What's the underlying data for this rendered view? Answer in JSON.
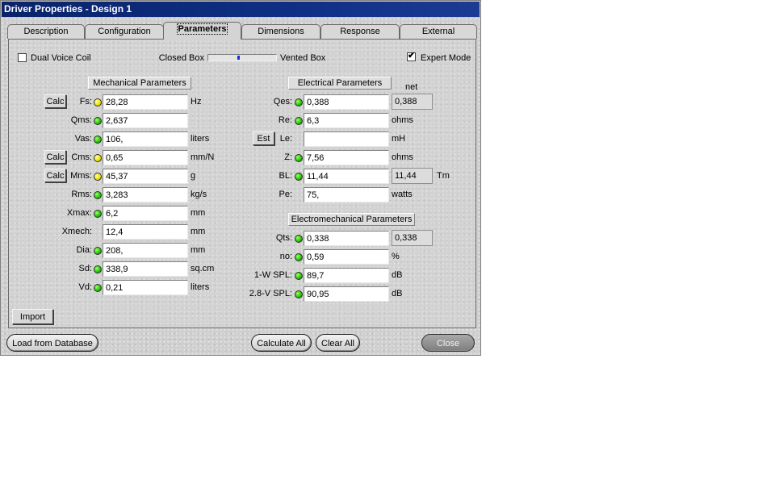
{
  "window": {
    "title": "Driver Properties - Design 1"
  },
  "tabs": [
    {
      "label": "Description"
    },
    {
      "label": "Configuration"
    },
    {
      "label": "Parameters"
    },
    {
      "label": "Dimensions"
    },
    {
      "label": "Response"
    },
    {
      "label": "External"
    }
  ],
  "active_tab": "Parameters",
  "top": {
    "dual_voice_coil": {
      "label": "Dual Voice Coil",
      "checked": false
    },
    "box_slider": {
      "left_label": "Closed Box",
      "right_label": "Vented Box",
      "position": 0.45
    },
    "expert_mode": {
      "label": "Expert Mode",
      "checked": true,
      "mark": "✔"
    }
  },
  "mechanical": {
    "header": "Mechanical Parameters",
    "rows": [
      {
        "label": "Fs:",
        "value": "28,28",
        "unit": "Hz",
        "led": "yellow",
        "button": "Calc"
      },
      {
        "label": "Qms:",
        "value": "2,637",
        "unit": "",
        "led": "green"
      },
      {
        "label": "Vas:",
        "value": "106,",
        "unit": "liters",
        "led": "green"
      },
      {
        "label": "Cms:",
        "value": "0,65",
        "unit": "mm/N",
        "led": "yellow",
        "button": "Calc"
      },
      {
        "label": "Mms:",
        "value": "45,37",
        "unit": "g",
        "led": "yellow",
        "button": "Calc"
      },
      {
        "label": "Rms:",
        "value": "3,283",
        "unit": "kg/s",
        "led": "green"
      },
      {
        "label": "Xmax:",
        "value": "6,2",
        "unit": "mm",
        "led": "green"
      },
      {
        "label": "Xmech:",
        "value": "12,4",
        "unit": "mm",
        "led": "none"
      },
      {
        "label": "Dia:",
        "value": "208,",
        "unit": "mm",
        "led": "green"
      },
      {
        "label": "Sd:",
        "value": "338,9",
        "unit": "sq.cm",
        "led": "green"
      },
      {
        "label": "Vd:",
        "value": "0,21",
        "unit": "liters",
        "led": "green"
      }
    ],
    "import_label": "Import"
  },
  "electrical": {
    "header": "Electrical Parameters",
    "net_header": "net",
    "rows": [
      {
        "label": "Qes:",
        "value": "0,388",
        "unit": "",
        "led": "green",
        "net": "0,388"
      },
      {
        "label": "Re:",
        "value": "6,3",
        "unit": "ohms",
        "led": "green"
      },
      {
        "label": "Le:",
        "value": "",
        "unit": "mH",
        "led": "none",
        "button": "Est"
      },
      {
        "label": "Z:",
        "value": "7,56",
        "unit": "ohms",
        "led": "green"
      },
      {
        "label": "BL:",
        "value": "11,44",
        "unit": "",
        "led": "green",
        "net": "11,44",
        "net_unit": "Tm"
      },
      {
        "label": "Pe:",
        "value": "75,",
        "unit": "watts",
        "led": "none"
      }
    ]
  },
  "electromechanical": {
    "header": "Electromechanical Parameters",
    "rows": [
      {
        "label": "Qts:",
        "value": "0,338",
        "unit": "",
        "led": "green",
        "net": "0,338"
      },
      {
        "label": "no:",
        "value": "0,59",
        "unit": "%",
        "led": "green"
      },
      {
        "label": "1-W SPL:",
        "value": "89,7",
        "unit": "dB",
        "led": "green"
      },
      {
        "label": "2.8-V SPL:",
        "value": "90,95",
        "unit": "dB",
        "led": "green"
      }
    ]
  },
  "bottom": {
    "load": "Load from Database",
    "calculate_all": "Calculate All",
    "clear_all": "Clear All",
    "close": "Close"
  },
  "colors": {
    "titlebar": "#0a246a",
    "led_green": "#20c000",
    "led_yellow": "#f0e000",
    "slider_thumb": "#1030e0"
  }
}
